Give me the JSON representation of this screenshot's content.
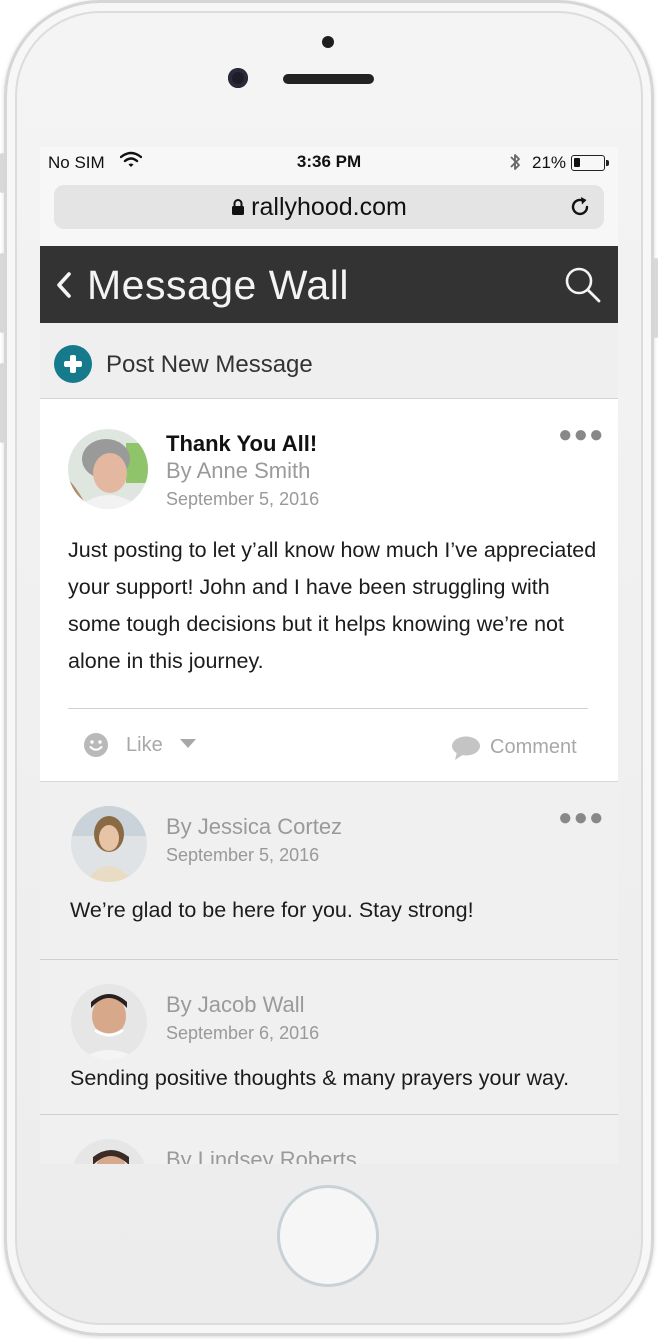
{
  "status_bar": {
    "carrier": "No SIM",
    "time": "3:36 PM",
    "battery_percent": "21%",
    "battery_level": 0.21
  },
  "browser": {
    "url": "rallyhood.com"
  },
  "header": {
    "title": "Message Wall"
  },
  "post_new": {
    "label": "Post New Message",
    "accent_color": "#157a8c"
  },
  "post": {
    "title": "Thank You All!",
    "author": "By Anne Smith",
    "date": "September 5, 2016",
    "body": "Just posting to let y’all know how much I’ve appreciated your support! John and I have been struggling with some tough decisions but it helps knowing we’re not alone in this journey.",
    "like_label": "Like",
    "comment_label": "Comment"
  },
  "replies": [
    {
      "author": "By Jessica Cortez",
      "date": "September 5, 2016",
      "text": "We’re glad to be here for you. Stay strong!"
    },
    {
      "author": "By Jacob Wall",
      "date": "September 6, 2016",
      "text": "Sending positive thoughts & many prayers your way."
    },
    {
      "author": "By Lindsey Roberts",
      "date": "",
      "text": ""
    }
  ],
  "colors": {
    "header_bg": "#333333",
    "accent": "#157a8c"
  },
  "icons": [
    "back-chevron-icon",
    "search-icon",
    "plus-icon",
    "smiley-icon",
    "caret-down-icon",
    "comment-bubble-icon",
    "more-icon",
    "lock-icon",
    "reload-icon",
    "wifi-icon",
    "bluetooth-icon",
    "battery-icon"
  ]
}
